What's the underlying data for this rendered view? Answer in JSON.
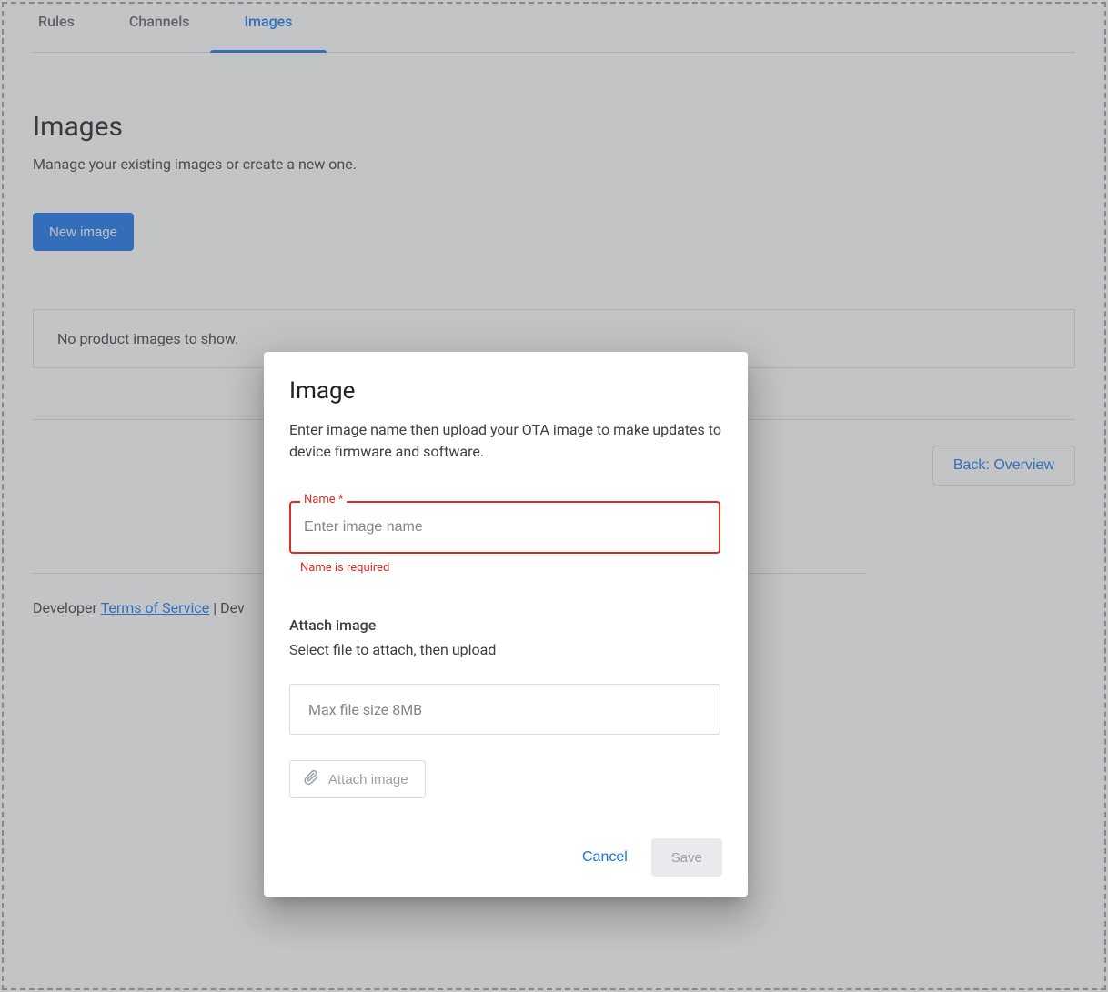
{
  "tabs": {
    "rules": "Rules",
    "channels": "Channels",
    "images": "Images"
  },
  "page": {
    "title": "Images",
    "subtitle": "Manage your existing images or create a new one.",
    "new_image_btn": "New image",
    "empty_message": "No product images to show.",
    "back_btn": "Back: Overview"
  },
  "footer": {
    "prefix": "Developer ",
    "tos": "Terms of Service",
    "sep": " | ",
    "dev_prefix": "Dev"
  },
  "dialog": {
    "title": "Image",
    "description": "Enter image name then upload your OTA image to make updates to device firmware and software.",
    "name_label": "Name *",
    "name_placeholder": "Enter image name",
    "name_error": "Name is required",
    "attach_title": "Attach image",
    "attach_sub": "Select file to attach, then upload",
    "file_placeholder": "Max file size 8MB",
    "attach_btn": "Attach image",
    "cancel": "Cancel",
    "save": "Save"
  }
}
